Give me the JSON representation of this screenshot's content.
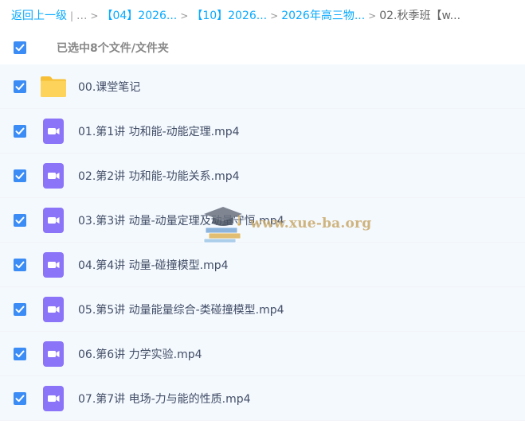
{
  "breadcrumb": {
    "back_label": "返回上一级",
    "separator": "|",
    "ellipsis": "...",
    "arrow": ">",
    "crumbs": [
      {
        "label": "【04】2026..."
      },
      {
        "label": "【10】2026..."
      },
      {
        "label": "2026年高三物..."
      }
    ],
    "current": "02.秋季班【w..."
  },
  "selection": {
    "summary": "已选中8个文件/文件夹",
    "checked": true
  },
  "files": [
    {
      "name": "00.课堂笔记",
      "type": "folder",
      "icon": "folder-icon",
      "checked": true
    },
    {
      "name": "01.第1讲 功和能-动能定理.mp4",
      "type": "video",
      "icon": "video-file-icon",
      "checked": true
    },
    {
      "name": "02.第2讲 功和能-功能关系.mp4",
      "type": "video",
      "icon": "video-file-icon",
      "checked": true
    },
    {
      "name": "03.第3讲 动量-动量定理及动量守恒.mp4",
      "type": "video",
      "icon": "video-file-icon",
      "checked": true
    },
    {
      "name": "04.第4讲 动量-碰撞模型.mp4",
      "type": "video",
      "icon": "video-file-icon",
      "checked": true
    },
    {
      "name": "05.第5讲 动量能量综合-类碰撞模型.mp4",
      "type": "video",
      "icon": "video-file-icon",
      "checked": true
    },
    {
      "name": "06.第6讲 力学实验.mp4",
      "type": "video",
      "icon": "video-file-icon",
      "checked": true
    },
    {
      "name": "07.第7讲 电场-力与能的性质.mp4",
      "type": "video",
      "icon": "video-file-icon",
      "checked": true
    }
  ],
  "watermark": {
    "text": "www.xue-ba.org",
    "icon": "graduation-cap-books-icon"
  },
  "colors": {
    "link": "#09aaff",
    "checkbox": "#3b8cf5",
    "row_background": "#f4f9fe",
    "folder": "#fdd35c",
    "video_icon": "#8b74f7",
    "file_text": "#424e67"
  }
}
